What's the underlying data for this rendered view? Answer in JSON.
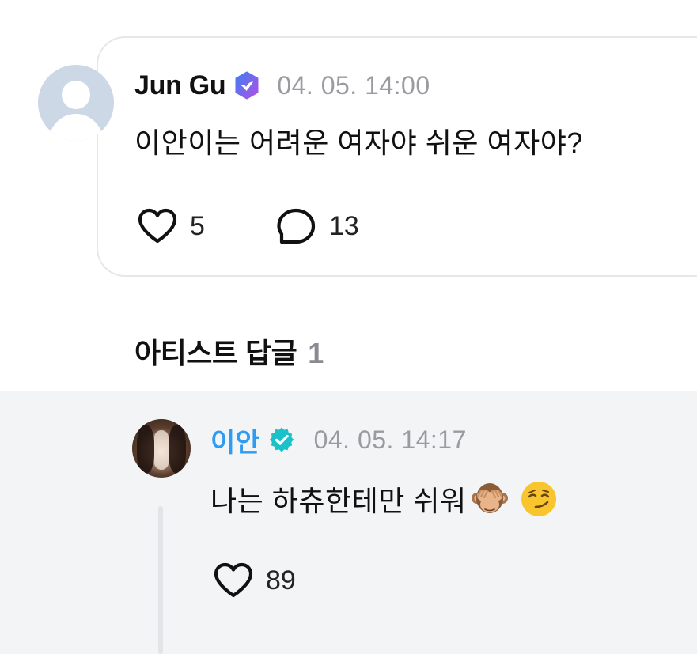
{
  "post": {
    "author": "Jun Gu",
    "timestamp": "04. 05. 14:00",
    "text": "이안이는 어려운 여자야 쉬운 여자야?",
    "likes": "5",
    "comments": "13"
  },
  "replies_section": {
    "title": "아티스트 답글",
    "count": "1"
  },
  "reply": {
    "author": "이안",
    "timestamp": "04. 05. 14:17",
    "text": "나는 하츄한테만 쉬워",
    "emojis": [
      "see-no-evil-monkey",
      "smirking-face"
    ],
    "likes": "89"
  },
  "colors": {
    "artist_name": "#2e9cf2",
    "verified_user": "#7b5cf0",
    "verified_artist": "#19c2c8",
    "panel_bg": "#f3f4f6"
  }
}
